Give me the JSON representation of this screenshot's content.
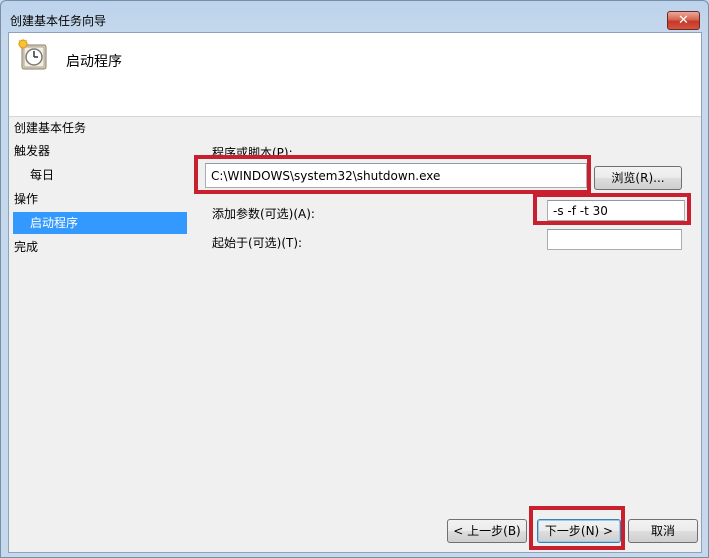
{
  "window": {
    "title": "创建基本任务向导",
    "close_glyph": "✕"
  },
  "header": {
    "title": "启动程序",
    "icon": "task-scheduler-clock-icon"
  },
  "nav": {
    "items": [
      {
        "label": "创建基本任务",
        "indent": false,
        "selected": false
      },
      {
        "label": "触发器",
        "indent": false,
        "selected": false
      },
      {
        "label": "每日",
        "indent": true,
        "selected": false
      },
      {
        "label": "操作",
        "indent": false,
        "selected": false
      },
      {
        "label": "启动程序",
        "indent": true,
        "selected": true
      },
      {
        "label": "完成",
        "indent": false,
        "selected": false
      }
    ]
  },
  "form": {
    "program_label": "程序或脚本(P):",
    "program_value": "C:\\WINDOWS\\system32\\shutdown.exe",
    "browse_label": "浏览(R)...",
    "args_label": "添加参数(可选)(A):",
    "args_value": "-s -f -t 30",
    "startin_label": "起始于(可选)(T):",
    "startin_value": ""
  },
  "footer": {
    "back_label": "< 上一步(B)",
    "next_label": "下一步(N) >",
    "cancel_label": "取消"
  },
  "colors": {
    "highlight": "#c8202e",
    "nav_selected": "#3399ff"
  }
}
